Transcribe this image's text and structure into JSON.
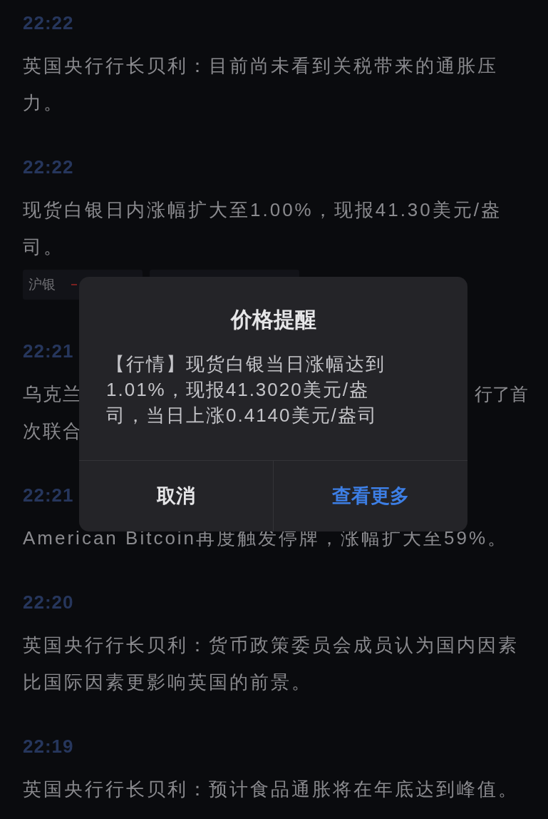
{
  "feed": [
    {
      "time": "22:22",
      "text": "英国央行行长贝利：目前尚未看到关税带来的通胀压力。"
    },
    {
      "time": "22:22",
      "text": "现货白银日内涨幅扩大至1.00%，现报41.30美元/盎司。",
      "tags": [
        {
          "label": "沪银"
        }
      ]
    },
    {
      "time": "22:21",
      "text_left": "乌克兰",
      "text_right": "行了首",
      "text_line_2": "次联合"
    },
    {
      "time": "22:21",
      "text": "American Bitcoin再度触发停牌，涨幅扩大至59%。"
    },
    {
      "time": "22:20",
      "text": "英国央行行长贝利：货币政策委员会成员认为国内因素比国际因素更影响英国的前景。"
    },
    {
      "time": "22:19",
      "text": "英国央行行长贝利：预计食品通胀将在年底达到峰值。"
    }
  ],
  "dialog": {
    "title": "价格提醒",
    "message": "【行情】现货白银当日涨幅达到1.01%，现报41.3020美元/盎司，当日上涨0.4140美元/盎司",
    "buttons": [
      {
        "label": "取消",
        "kind": "cancel"
      },
      {
        "label": "查看更多",
        "kind": "primary"
      }
    ]
  }
}
